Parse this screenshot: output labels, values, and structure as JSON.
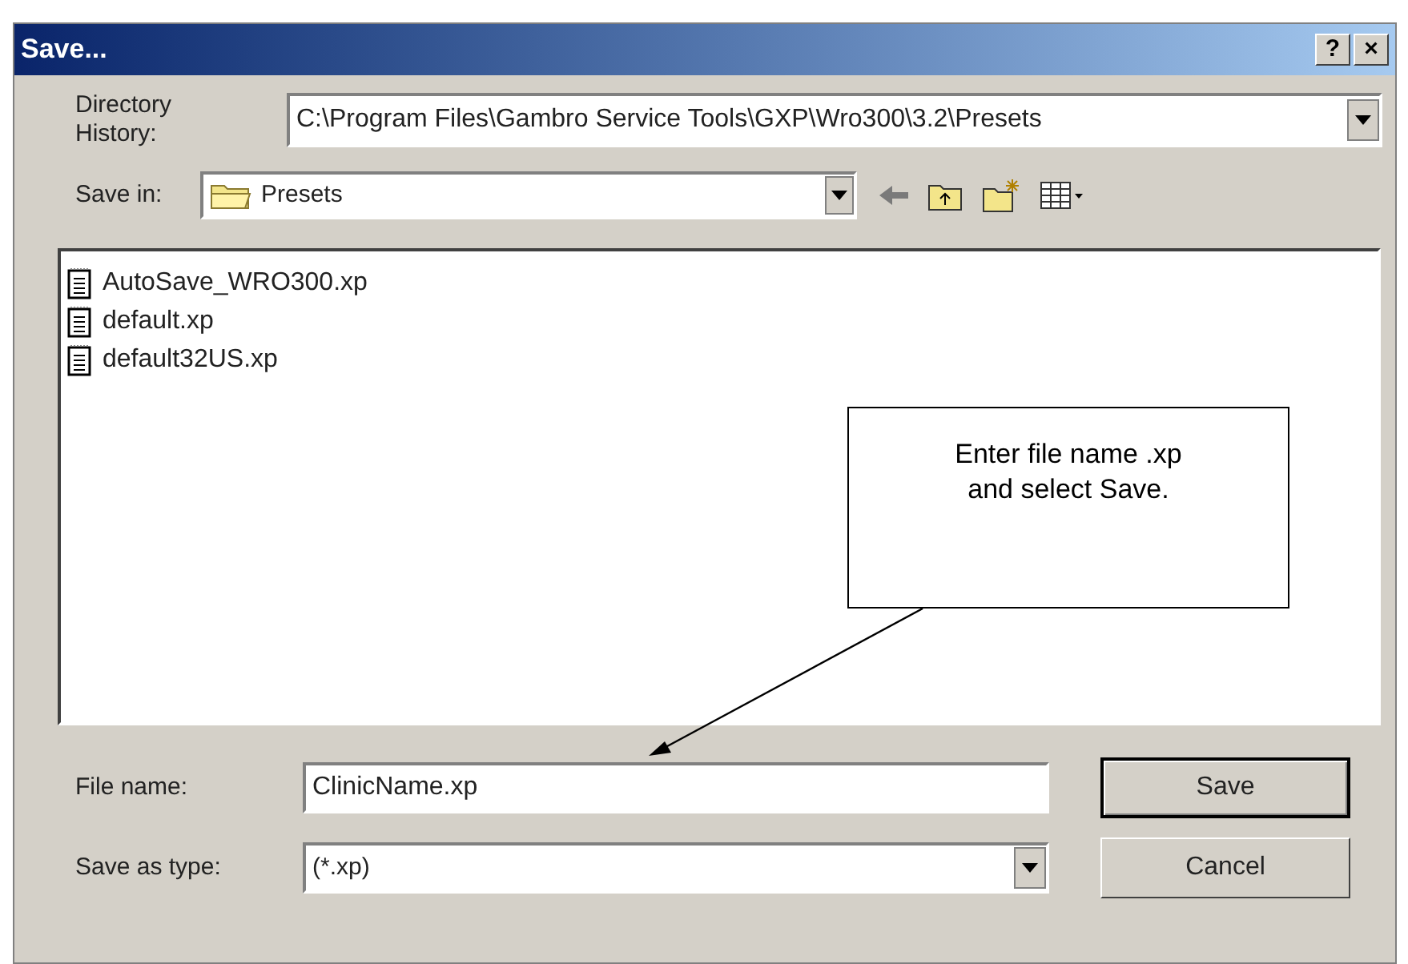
{
  "window": {
    "title": "Save...",
    "buttons": [
      "?",
      "×"
    ]
  },
  "directory_history": {
    "label": "Directory History:",
    "value": "C:\\Program Files\\Gambro Service Tools\\GXP\\Wro300\\3.2\\Presets"
  },
  "save_in": {
    "label": "Save in:",
    "value": "Presets"
  },
  "files": [
    {
      "name": "AutoSave_WRO300.xp"
    },
    {
      "name": "default.xp"
    },
    {
      "name": "default32US.xp"
    }
  ],
  "callout": {
    "text": "Enter file name .xp and select Save."
  },
  "file_name": {
    "label": "File name:",
    "value": "ClinicName.xp"
  },
  "save_as_type": {
    "label": "Save as type:",
    "value": "(*.xp)"
  },
  "buttons": [
    {
      "label": "Save",
      "kind": "default"
    },
    {
      "label": "Cancel",
      "kind": "normal"
    }
  ]
}
